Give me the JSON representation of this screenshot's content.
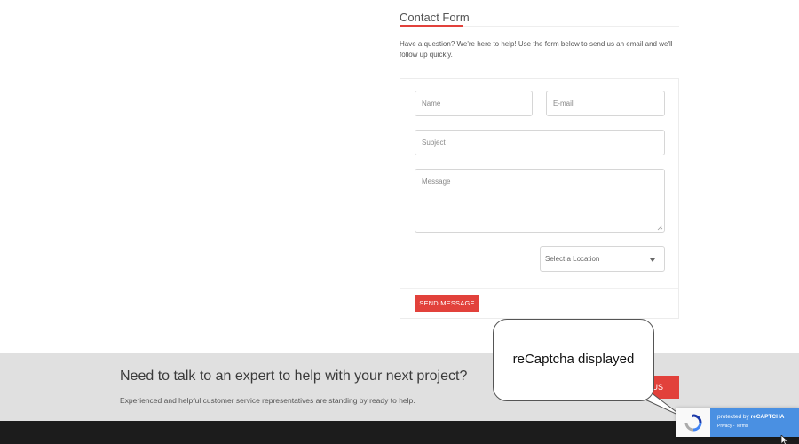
{
  "contact": {
    "title": "Contact Form",
    "intro": "Have a question? We're here to help! Use the form below to send us an email and we'll follow up quickly."
  },
  "form": {
    "name_placeholder": "Name",
    "email_placeholder": "E-mail",
    "subject_placeholder": "Subject",
    "message_placeholder": "Message",
    "location_selected": "Select a Location",
    "send_label": "SEND MESSAGE"
  },
  "band": {
    "title": "Need to talk to an expert to help with your next project?",
    "subtitle": "Experienced and helpful customer service representatives are standing by ready to help.",
    "button_visible_text": "US"
  },
  "annotation": {
    "text": "reCaptcha displayed"
  },
  "recaptcha": {
    "prefix": "protected by ",
    "brand": "reCAPTCHA",
    "links": "Privacy - Terms"
  },
  "colors": {
    "accent": "#e2413b",
    "band_bg": "#e0e0e0",
    "footer_bg": "#1c1c1c",
    "recaptcha_blue": "#4a90e2"
  },
  "icons": {
    "dropdown": "chevron-down-icon",
    "recaptcha_logo": "recaptcha-logo-icon",
    "cursor": "mouse-pointer-icon"
  }
}
